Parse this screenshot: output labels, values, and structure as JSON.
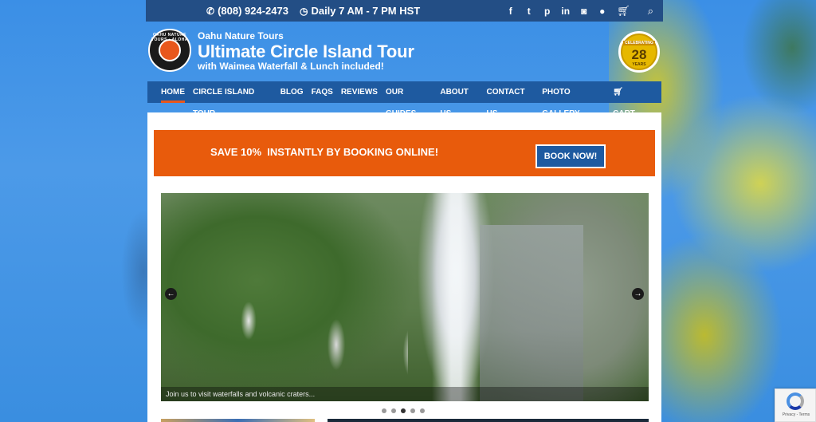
{
  "topbar": {
    "phone": "(808) 924-2473",
    "hours": "Daily 7 AM - 7 PM HST",
    "social_icons": [
      "facebook-icon",
      "twitter-icon",
      "pinterest-icon",
      "linkedin-icon",
      "instagram-icon",
      "flickr-icon"
    ],
    "tool_icons": [
      "cart-icon",
      "search-icon"
    ]
  },
  "header": {
    "company": "Oahu Nature Tours",
    "title": "Ultimate Circle Island Tour",
    "subtitle": "with Waimea Waterfall & Lunch included!",
    "logo_text": "OAHU NATURE TOURS · ALOHA",
    "badge": {
      "celebrating": "CELEBRATING",
      "years_num": "28",
      "years_label": "YEARS"
    }
  },
  "nav": {
    "items": [
      {
        "label": "HOME"
      },
      {
        "label": "CIRCLE ISLAND TOUR"
      },
      {
        "label": "BLOG"
      },
      {
        "label": "FAQS"
      },
      {
        "label": "REVIEWS"
      },
      {
        "label": "OUR GUIDES"
      },
      {
        "label": "ABOUT US"
      },
      {
        "label": "CONTACT US"
      },
      {
        "label": "PHOTO GALLERY"
      }
    ],
    "cart_label": "CART"
  },
  "promo": {
    "text": "SAVE 10%  INSTANTLY BY BOOKING ONLINE!",
    "button": "BOOK NOW!"
  },
  "slider": {
    "caption": "Join us to visit waterfalls and volcanic craters...",
    "dots_count": 5,
    "active_dot": 3
  },
  "recaptcha": {
    "text": "Privacy - Terms"
  },
  "colors": {
    "topbar": "#234e85",
    "nav": "#1e5aa0",
    "promo": "#e85b0c",
    "sky": "#3f8fe0"
  }
}
